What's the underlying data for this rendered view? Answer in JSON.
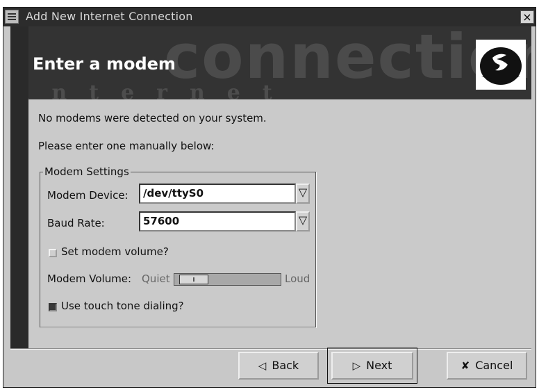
{
  "window": {
    "title": "Add New Internet Connection",
    "close_glyph": "×"
  },
  "header": {
    "title": "Enter a modem",
    "watermark": "connection",
    "watermark_dots": "internet"
  },
  "messages": {
    "no_modems": "No modems were detected on your system.",
    "enter_manually": "Please enter one manually below:"
  },
  "modem_settings": {
    "legend": "Modem Settings",
    "device_label": "Modem Device:",
    "device_value": "/dev/ttyS0",
    "baud_label": "Baud Rate:",
    "baud_value": "57600",
    "combo_arrow": "▽",
    "set_volume_label": "Set modem volume?",
    "set_volume_checked": false,
    "volume_label": "Modem Volume:",
    "volume_quiet": "Quiet",
    "volume_loud": "Loud",
    "volume_level": 0.05,
    "touch_tone_label": "Use touch tone dialing?",
    "touch_tone_checked": true
  },
  "buttons": {
    "back": {
      "label": "Back",
      "icon": "◁"
    },
    "next": {
      "label": "Next",
      "icon": "▷"
    },
    "cancel": {
      "label": "Cancel",
      "icon": "✘"
    }
  }
}
